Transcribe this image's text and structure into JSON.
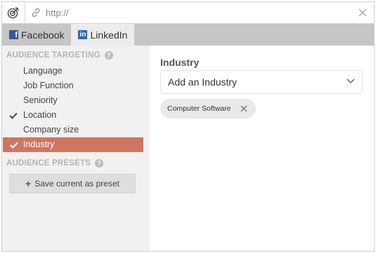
{
  "urlbar": {
    "placeholder": "http://",
    "value": ""
  },
  "tabs": [
    {
      "label": "Facebook",
      "active": false,
      "icon": "facebook-icon"
    },
    {
      "label": "LinkedIn",
      "active": true,
      "icon": "linkedin-icon"
    }
  ],
  "sidebar": {
    "targeting_header": "AUDIENCE TARGETING",
    "items": [
      {
        "label": "Language",
        "checked": false,
        "selected": false
      },
      {
        "label": "Job Function",
        "checked": false,
        "selected": false
      },
      {
        "label": "Seniority",
        "checked": false,
        "selected": false
      },
      {
        "label": "Location",
        "checked": true,
        "selected": false
      },
      {
        "label": "Company size",
        "checked": false,
        "selected": false
      },
      {
        "label": "Industry",
        "checked": true,
        "selected": true
      }
    ],
    "presets_header": "AUDIENCE PRESETS",
    "save_preset_label": "Save current as preset"
  },
  "main": {
    "field_label": "Industry",
    "dropdown_placeholder": "Add an Industry",
    "chips": [
      {
        "label": "Computer Software"
      }
    ]
  },
  "colors": {
    "selected_row": "#d07660",
    "tab_bar": "#c6c6c6",
    "sidebar_bg": "#f1f1f1",
    "facebook": "#375a9a",
    "linkedin": "#2b6bb3"
  }
}
